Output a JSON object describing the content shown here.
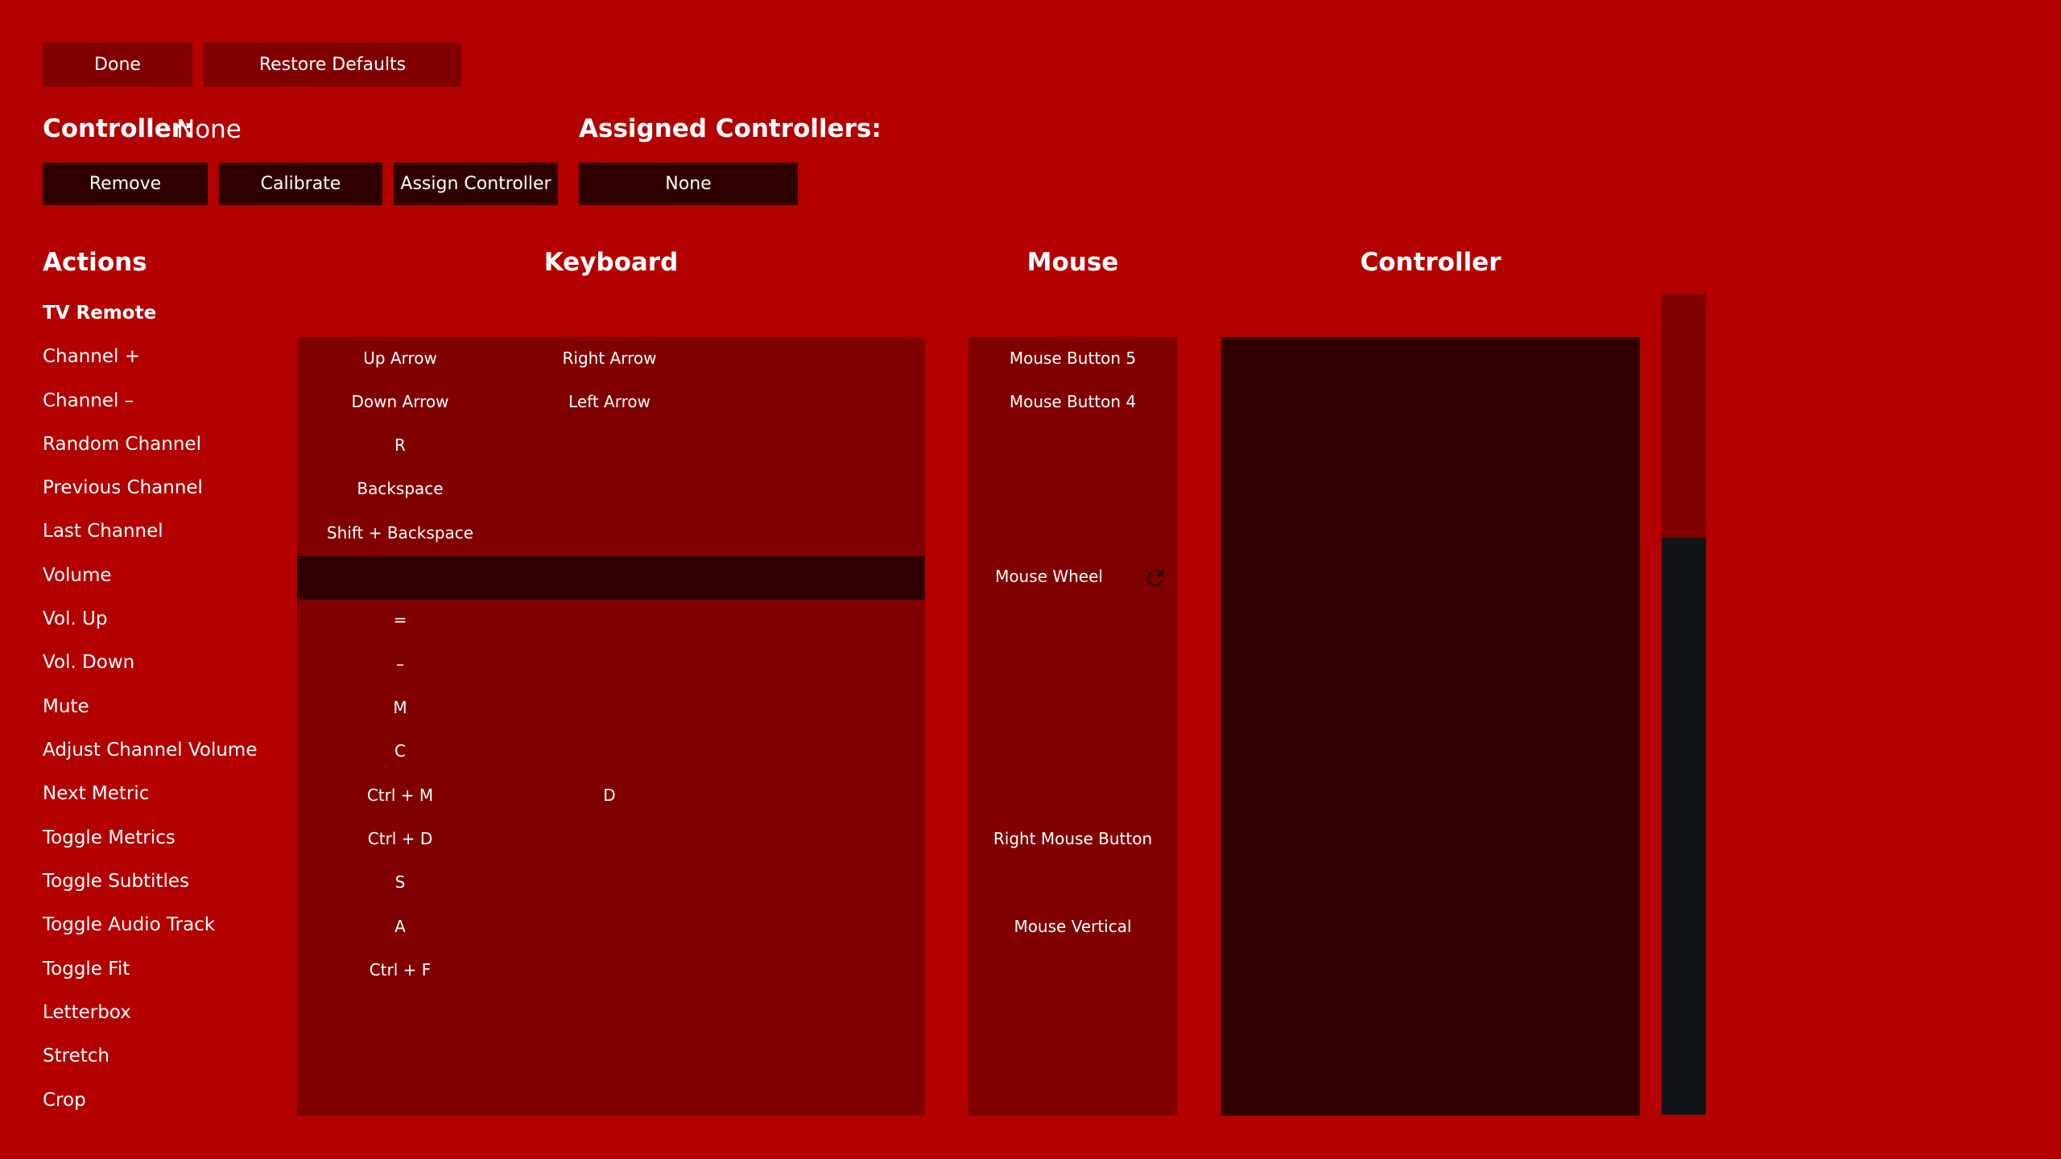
{
  "toolbar": {
    "done_label": "Done",
    "restore_label": "Restore Defaults"
  },
  "controller": {
    "label": "Controller:",
    "value": "None",
    "remove_label": "Remove",
    "calibrate_label": "Calibrate",
    "assign_label": "Assign Controller"
  },
  "assigned": {
    "label": "Assigned Controllers:",
    "value": "None"
  },
  "columns": {
    "actions": "Actions",
    "keyboard": "Keyboard",
    "mouse": "Mouse",
    "controller": "Controller"
  },
  "actions": [
    {
      "name": "TV Remote",
      "group": true,
      "kb1": "",
      "kb2": "",
      "mouse": ""
    },
    {
      "name": "Channel +",
      "kb1": "Up Arrow",
      "kb2": "Right Arrow",
      "mouse": "Mouse Button 5"
    },
    {
      "name": "Channel –",
      "kb1": "Down Arrow",
      "kb2": "Left Arrow",
      "mouse": "Mouse Button 4"
    },
    {
      "name": "Random Channel",
      "kb1": "R",
      "kb2": "",
      "mouse": ""
    },
    {
      "name": "Previous Channel",
      "kb1": "Backspace",
      "kb2": "",
      "mouse": ""
    },
    {
      "name": "Last Channel",
      "kb1": "Shift + Backspace",
      "kb2": "",
      "mouse": ""
    },
    {
      "name": "Volume",
      "kb1": "",
      "kb2": "",
      "mouse": "Mouse Wheel",
      "selected": true
    },
    {
      "name": "Vol. Up",
      "kb1": "=",
      "kb2": "",
      "mouse": ""
    },
    {
      "name": "Vol. Down",
      "kb1": "–",
      "kb2": "",
      "mouse": ""
    },
    {
      "name": "Mute",
      "kb1": "M",
      "kb2": "",
      "mouse": ""
    },
    {
      "name": "Adjust Channel Volume",
      "kb1": "C",
      "kb2": "",
      "mouse": ""
    },
    {
      "name": "Next Metric",
      "kb1": "Ctrl + M",
      "kb2": "D",
      "mouse": ""
    },
    {
      "name": "Toggle Metrics",
      "kb1": "Ctrl + D",
      "kb2": "",
      "mouse": "Right Mouse Button"
    },
    {
      "name": "Toggle Subtitles",
      "kb1": "S",
      "kb2": "",
      "mouse": ""
    },
    {
      "name": "Toggle Audio Track",
      "kb1": "A",
      "kb2": "",
      "mouse": "Mouse Vertical"
    },
    {
      "name": "Toggle Fit",
      "kb1": "Ctrl + F",
      "kb2": "",
      "mouse": ""
    },
    {
      "name": "Letterbox",
      "kb1": "",
      "kb2": "",
      "mouse": ""
    },
    {
      "name": "Stretch",
      "kb1": "",
      "kb2": "",
      "mouse": ""
    },
    {
      "name": "Crop",
      "kb1": "",
      "kb2": "",
      "mouse": ""
    }
  ],
  "icons": {
    "reset": "reset-icon"
  },
  "colors": {
    "background": "#b30000",
    "panel": "#800000",
    "panel_dark": "#300000",
    "scroll_track": "#111518"
  }
}
